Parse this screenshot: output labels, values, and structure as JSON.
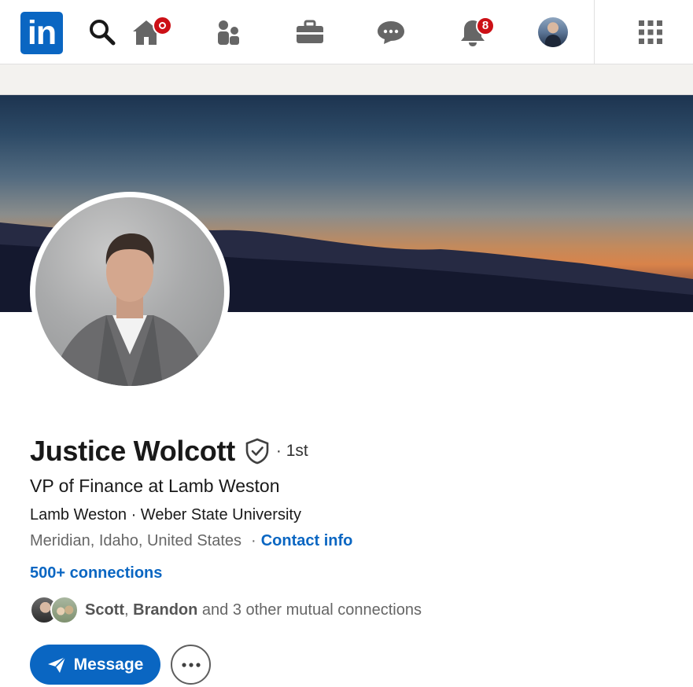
{
  "nav": {
    "logo_text": "in",
    "notifications_count": "8",
    "icons": [
      "search-icon",
      "home-icon",
      "my-network-icon",
      "jobs-icon",
      "messaging-icon",
      "notifications-icon",
      "me-avatar",
      "work-grid-icon"
    ],
    "brand_color": "#0a66c2",
    "badge_color": "#cc1016"
  },
  "profile": {
    "name": "Justice Wolcott",
    "degree": "· 1st",
    "headline": "VP of Finance at Lamb Weston",
    "orgs": "Lamb Weston · Weber State University",
    "location": "Meridian, Idaho, United States",
    "location_separator": "·",
    "contact_info": "Contact info",
    "connections": "500+ connections",
    "mutual": {
      "name1": "Scott",
      "separator": ", ",
      "name2": "Brandon",
      "rest": " and 3 other mutual connections"
    }
  },
  "actions": {
    "message_label": "Message",
    "more_label": "···"
  }
}
